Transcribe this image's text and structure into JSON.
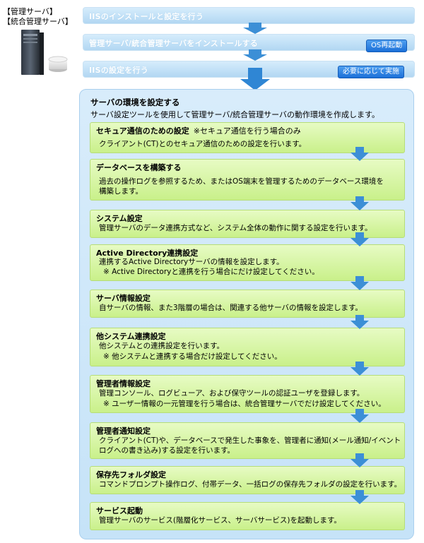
{
  "left_panel": {
    "line1": "【管理サーバ】",
    "line2": "【統合管理サーバ】"
  },
  "top_steps": [
    {
      "label": "IISのインストールと設定を行う",
      "badge": ""
    },
    {
      "label": "管理サーバ/統合管理サーバをインストールする",
      "badge": "OS再起動"
    },
    {
      "label": "IISの設定を行う",
      "badge": "必要に応じて実施"
    }
  ],
  "main": {
    "title": "サーバの環境を設定する",
    "description": "サーバ設定ツールを使用して管理サーバ/統合管理サーバの動作環境を作成します。",
    "sections": [
      {
        "title": "セキュア通信のための設定",
        "note": "※セキュア通信を行う場合のみ",
        "lines": [
          "クライアント(CT)とのセキュア通信のための設定を行います。"
        ]
      },
      {
        "title": "データベースを構築する",
        "note": "",
        "lines": [
          "過去の操作ログを参照するため、またはOS端末を管理するためのデータベース環境を",
          "構築します。"
        ]
      },
      {
        "title": "システム設定",
        "note": "",
        "lines": [
          "管理サーバのデータ連携方式など、システム全体の動作に関する設定を行います。"
        ]
      },
      {
        "title": "Active Directory連携設定",
        "note": "",
        "lines": [
          "連携するActive Directoryサーバの情報を設定します。",
          "※ Active Directoryと連携を行う場合にだけ設定してください。"
        ]
      },
      {
        "title": "サーバ情報設定",
        "note": "",
        "lines": [
          "自サーバの情報、また3階層の場合は、関連する他サーバの情報を設定します。"
        ]
      },
      {
        "title": "他システム連携設定",
        "note": "",
        "lines": [
          "他システムとの連携設定を行います。",
          "※ 他システムと連携する場合だけ設定してください。"
        ]
      },
      {
        "title": "管理者情報設定",
        "note": "",
        "lines": [
          "管理コンソール、ログビューア、および保守ツールの認証ユーザを登録します。",
          "※ ユーザー情報の一元管理を行う場合は、統合管理サーバでだけ設定してください。"
        ]
      },
      {
        "title": "管理者通知設定",
        "note": "",
        "lines": [
          "クライアント(CT)や、データベースで発生した事象を、管理者に通知(メール通知/イベント",
          "ログへの書き込み)する設定を行います。"
        ]
      },
      {
        "title": "保存先フォルダ設定",
        "note": "",
        "lines": [
          "コマンドプロンプト操作ログ、付帯データ、一括ログの保存先フォルダの設定を行います。"
        ]
      },
      {
        "title": "サービス起動",
        "note": "",
        "lines": [
          "管理サーバのサービス(階層化サービス、サーバサービス)を起動します。"
        ]
      }
    ]
  },
  "colors": {
    "arrow": "#3c8fd6",
    "badge": "#1f74dc",
    "green": "#d2f39c",
    "blue_panel": "#cfe7f9"
  }
}
